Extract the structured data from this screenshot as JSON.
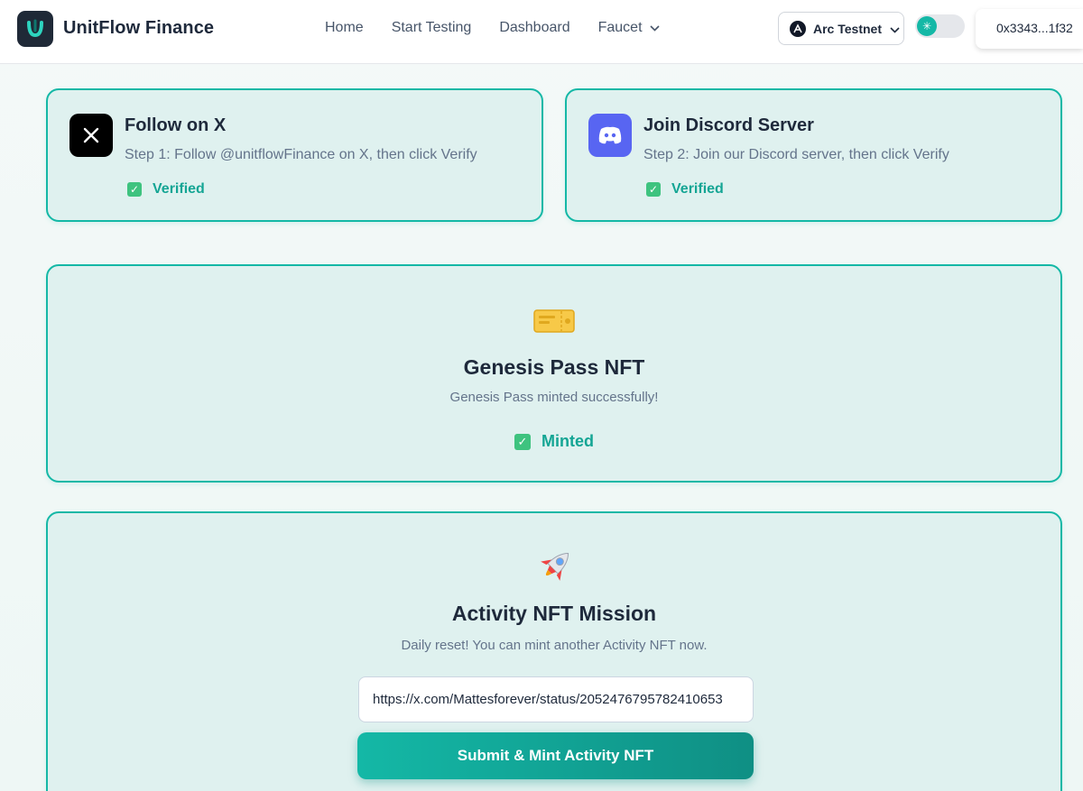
{
  "header": {
    "brand": "UnitFlow Finance",
    "nav": [
      {
        "label": "Home"
      },
      {
        "label": "Start Testing"
      },
      {
        "label": "Dashboard"
      },
      {
        "label": "Faucet"
      }
    ],
    "network": "Arc Testnet",
    "wallet": "0x3343...1f32"
  },
  "tasks": {
    "x": {
      "title": "Follow on X",
      "description": "Step 1: Follow @unitflowFinance on X, then click Verify",
      "status": "Verified",
      "icon": "x-logo-icon"
    },
    "discord": {
      "title": "Join Discord Server",
      "description": "Step 2: Join our Discord server, then click Verify",
      "status": "Verified",
      "icon": "discord-logo-icon"
    }
  },
  "genesis": {
    "emoji": "🎫",
    "title": "Genesis Pass NFT",
    "subtitle": "Genesis Pass minted successfully!",
    "status": "Minted"
  },
  "mission": {
    "emoji": "🚀",
    "title": "Activity NFT Mission",
    "subtitle": "Daily reset! You can mint another Activity NFT now.",
    "url_value": "https://x.com/Mattesforever/status/2052476795782410653",
    "button_label": "Submit & Mint Activity NFT"
  },
  "colors": {
    "accent": "#14b8a6",
    "card_bg": "#dff1ef",
    "verified": "#14a594",
    "discord": "#5865f2"
  }
}
